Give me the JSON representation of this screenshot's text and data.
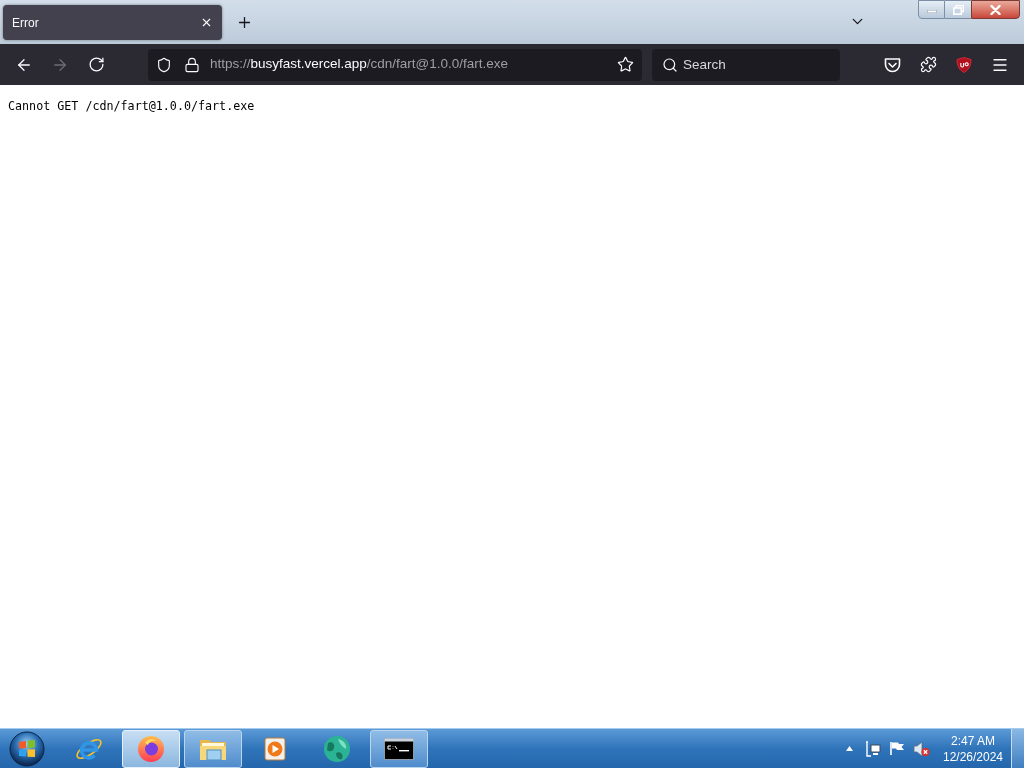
{
  "tabs": [
    {
      "title": "Error",
      "selected": true
    }
  ],
  "toolbar": {
    "back": {
      "disabled": false
    },
    "forward": {
      "disabled": true
    },
    "address": {
      "scheme": "https://",
      "host": "busyfast.vercel.app",
      "path": "/cdn/fart@1.0.0/fart.exe"
    },
    "search": {
      "placeholder": "Search"
    }
  },
  "page": {
    "message": "Cannot GET /cdn/fart@1.0.0/fart.exe"
  },
  "taskbar": {
    "items": [
      {
        "kind": "ie",
        "running": false,
        "active": false
      },
      {
        "kind": "firefox",
        "running": true,
        "active": true
      },
      {
        "kind": "explorer",
        "running": true,
        "active": false
      },
      {
        "kind": "media",
        "running": false,
        "active": false
      },
      {
        "kind": "globe",
        "running": false,
        "active": false
      },
      {
        "kind": "terminal",
        "running": true,
        "active": false
      }
    ],
    "tray": {
      "volume_muted": true
    },
    "clock": {
      "time": "2:47 AM",
      "date": "12/26/2024"
    }
  }
}
